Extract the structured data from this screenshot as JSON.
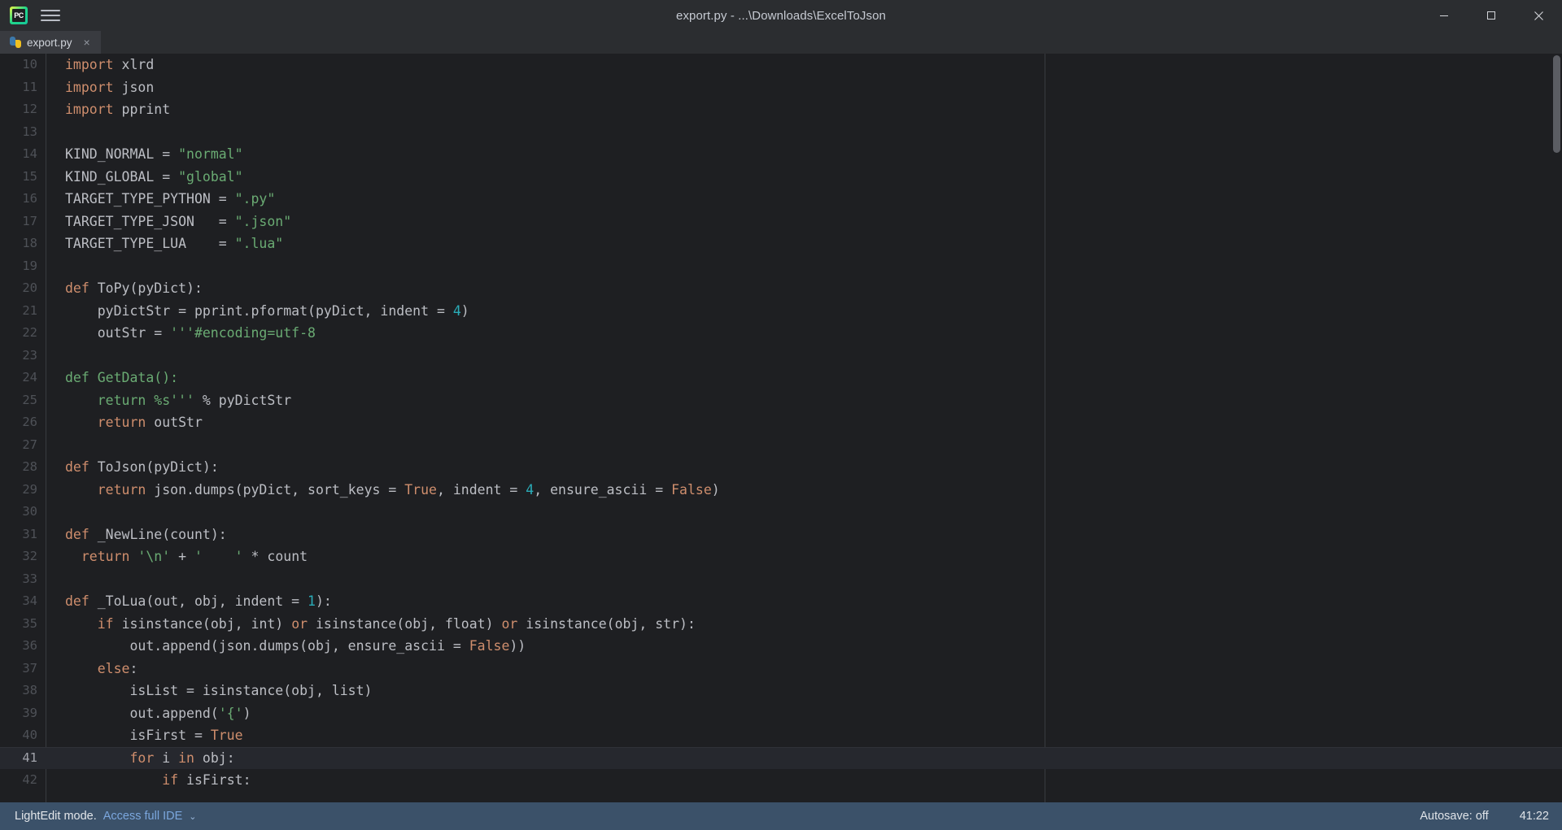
{
  "window": {
    "title": "export.py - ...\\Downloads\\ExcelToJson",
    "app_icon": "pycharm-logo-icon",
    "app_icon_label": "PC",
    "menu_icon": "hamburger-menu-icon",
    "minimize_icon": "minimize-icon",
    "maximize_icon": "maximize-icon",
    "close_icon": "close-icon"
  },
  "tabs": [
    {
      "label": "export.py",
      "icon": "python-file-icon",
      "close": "×",
      "active": true
    }
  ],
  "editor": {
    "caret_line": 41,
    "lines": [
      {
        "n": 10,
        "tokens": [
          {
            "t": "import ",
            "c": "kw"
          },
          {
            "t": "xlrd",
            "c": "def"
          }
        ]
      },
      {
        "n": 11,
        "tokens": [
          {
            "t": "import ",
            "c": "kw"
          },
          {
            "t": "json",
            "c": "def"
          }
        ]
      },
      {
        "n": 12,
        "tokens": [
          {
            "t": "import ",
            "c": "kw"
          },
          {
            "t": "pprint",
            "c": "def"
          }
        ]
      },
      {
        "n": 13,
        "tokens": []
      },
      {
        "n": 14,
        "tokens": [
          {
            "t": "KIND_NORMAL = ",
            "c": "def"
          },
          {
            "t": "\"normal\"",
            "c": "str"
          }
        ]
      },
      {
        "n": 15,
        "tokens": [
          {
            "t": "KIND_GLOBAL = ",
            "c": "def"
          },
          {
            "t": "\"global\"",
            "c": "str"
          }
        ]
      },
      {
        "n": 16,
        "tokens": [
          {
            "t": "TARGET_TYPE_PYTHON = ",
            "c": "def"
          },
          {
            "t": "\".py\"",
            "c": "str"
          }
        ]
      },
      {
        "n": 17,
        "tokens": [
          {
            "t": "TARGET_TYPE_JSON   = ",
            "c": "def"
          },
          {
            "t": "\".json\"",
            "c": "str"
          }
        ]
      },
      {
        "n": 18,
        "tokens": [
          {
            "t": "TARGET_TYPE_LUA    = ",
            "c": "def"
          },
          {
            "t": "\".lua\"",
            "c": "str"
          }
        ]
      },
      {
        "n": 19,
        "tokens": []
      },
      {
        "n": 20,
        "tokens": [
          {
            "t": "def ",
            "c": "kw"
          },
          {
            "t": "ToPy(pyDict):",
            "c": "def"
          }
        ]
      },
      {
        "n": 21,
        "tokens": [
          {
            "t": "    pyDictStr = pprint.pformat(pyDict, indent = ",
            "c": "def"
          },
          {
            "t": "4",
            "c": "num"
          },
          {
            "t": ")",
            "c": "def"
          }
        ]
      },
      {
        "n": 22,
        "tokens": [
          {
            "t": "    outStr = ",
            "c": "def"
          },
          {
            "t": "'''#encoding=utf-8",
            "c": "str"
          }
        ]
      },
      {
        "n": 23,
        "tokens": []
      },
      {
        "n": 24,
        "tokens": [
          {
            "t": "def GetData():",
            "c": "str"
          }
        ]
      },
      {
        "n": 25,
        "tokens": [
          {
            "t": "    return %s'''",
            "c": "str"
          },
          {
            "t": " % pyDictStr",
            "c": "def"
          }
        ]
      },
      {
        "n": 26,
        "tokens": [
          {
            "t": "    ",
            "c": "def"
          },
          {
            "t": "return ",
            "c": "kw"
          },
          {
            "t": "outStr",
            "c": "def"
          }
        ]
      },
      {
        "n": 27,
        "tokens": []
      },
      {
        "n": 28,
        "tokens": [
          {
            "t": "def ",
            "c": "kw"
          },
          {
            "t": "ToJson(pyDict):",
            "c": "def"
          }
        ]
      },
      {
        "n": 29,
        "tokens": [
          {
            "t": "    ",
            "c": "def"
          },
          {
            "t": "return ",
            "c": "kw"
          },
          {
            "t": "json.dumps(pyDict, sort_keys = ",
            "c": "def"
          },
          {
            "t": "True",
            "c": "kw"
          },
          {
            "t": ", indent = ",
            "c": "def"
          },
          {
            "t": "4",
            "c": "num"
          },
          {
            "t": ", ensure_ascii = ",
            "c": "def"
          },
          {
            "t": "False",
            "c": "kw"
          },
          {
            "t": ")",
            "c": "def"
          }
        ]
      },
      {
        "n": 30,
        "tokens": []
      },
      {
        "n": 31,
        "tokens": [
          {
            "t": "def ",
            "c": "kw"
          },
          {
            "t": "_NewLine(count):",
            "c": "def"
          }
        ]
      },
      {
        "n": 32,
        "tokens": [
          {
            "t": "  ",
            "c": "def"
          },
          {
            "t": "return ",
            "c": "kw"
          },
          {
            "t": "'\\n'",
            "c": "str"
          },
          {
            "t": " + ",
            "c": "def"
          },
          {
            "t": "'    '",
            "c": "str"
          },
          {
            "t": " * count",
            "c": "def"
          }
        ]
      },
      {
        "n": 33,
        "tokens": []
      },
      {
        "n": 34,
        "tokens": [
          {
            "t": "def ",
            "c": "kw"
          },
          {
            "t": "_ToLua(out, obj, indent = ",
            "c": "def"
          },
          {
            "t": "1",
            "c": "num"
          },
          {
            "t": "):",
            "c": "def"
          }
        ]
      },
      {
        "n": 35,
        "tokens": [
          {
            "t": "    ",
            "c": "def"
          },
          {
            "t": "if ",
            "c": "kw"
          },
          {
            "t": "isinstance(obj, int) ",
            "c": "def"
          },
          {
            "t": "or ",
            "c": "kw"
          },
          {
            "t": "isinstance(obj, float) ",
            "c": "def"
          },
          {
            "t": "or ",
            "c": "kw"
          },
          {
            "t": "isinstance(obj, str):",
            "c": "def"
          }
        ]
      },
      {
        "n": 36,
        "tokens": [
          {
            "t": "        out.append(json.dumps(obj, ensure_ascii = ",
            "c": "def"
          },
          {
            "t": "False",
            "c": "kw"
          },
          {
            "t": "))",
            "c": "def"
          }
        ]
      },
      {
        "n": 37,
        "tokens": [
          {
            "t": "    ",
            "c": "def"
          },
          {
            "t": "else",
            "c": "kw"
          },
          {
            "t": ":",
            "c": "def"
          }
        ]
      },
      {
        "n": 38,
        "tokens": [
          {
            "t": "        isList = isinstance(obj, list)",
            "c": "def"
          }
        ]
      },
      {
        "n": 39,
        "tokens": [
          {
            "t": "        out.append(",
            "c": "def"
          },
          {
            "t": "'{'",
            "c": "str"
          },
          {
            "t": ")",
            "c": "def"
          }
        ]
      },
      {
        "n": 40,
        "tokens": [
          {
            "t": "        isFirst = ",
            "c": "def"
          },
          {
            "t": "True",
            "c": "kw"
          }
        ]
      },
      {
        "n": 41,
        "tokens": [
          {
            "t": "        ",
            "c": "def"
          },
          {
            "t": "for ",
            "c": "kw"
          },
          {
            "t": "i ",
            "c": "def"
          },
          {
            "t": "in ",
            "c": "kw"
          },
          {
            "t": "obj:",
            "c": "def"
          }
        ]
      },
      {
        "n": 42,
        "tokens": [
          {
            "t": "            ",
            "c": "def"
          },
          {
            "t": "if ",
            "c": "kw"
          },
          {
            "t": "isFirst:",
            "c": "def"
          }
        ]
      }
    ]
  },
  "statusbar": {
    "mode_text": "LightEdit mode.",
    "link_text": "Access full IDE",
    "chevron": "⌄",
    "autosave": "Autosave: off",
    "position": "41:22"
  },
  "colors": {
    "editor_bg": "#1E1F22",
    "chrome_bg": "#2B2D30",
    "tab_active_bg": "#393B40",
    "status_bg": "#3B5169",
    "keyword": "#CF8E6D",
    "string": "#6AAB73",
    "number": "#2AACB8",
    "text": "#BCBEC4",
    "link": "#7BA7DE"
  }
}
